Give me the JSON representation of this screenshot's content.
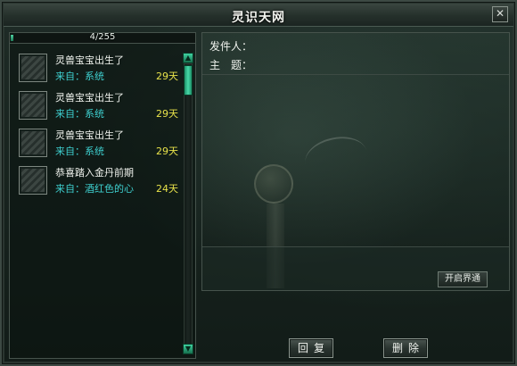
{
  "window": {
    "title": "灵识天网",
    "close_label": "✕"
  },
  "counter": {
    "text": "4/255",
    "fill_fraction": 0.0157
  },
  "mails": [
    {
      "subject": "灵兽宝宝出生了",
      "from": "来自：系统",
      "days": "29天"
    },
    {
      "subject": "灵兽宝宝出生了",
      "from": "来自：系统",
      "days": "29天"
    },
    {
      "subject": "灵兽宝宝出生了",
      "from": "来自：系统",
      "days": "29天"
    },
    {
      "subject": "恭喜踏入金丹前期",
      "from": "来自：酒红色的心",
      "days": "24天"
    }
  ],
  "scroll": {
    "up_icon": "▲",
    "down_icon": "▼"
  },
  "detail": {
    "sender_label": "发件人：",
    "subject_label": "主　题：",
    "open_button": "开启界通"
  },
  "actions": {
    "reply_label": "回复",
    "delete_label": "删除"
  },
  "colors": {
    "from_text": "#3ecfcf",
    "days_text": "#e8e24a",
    "accent": "#2fbf8a"
  }
}
